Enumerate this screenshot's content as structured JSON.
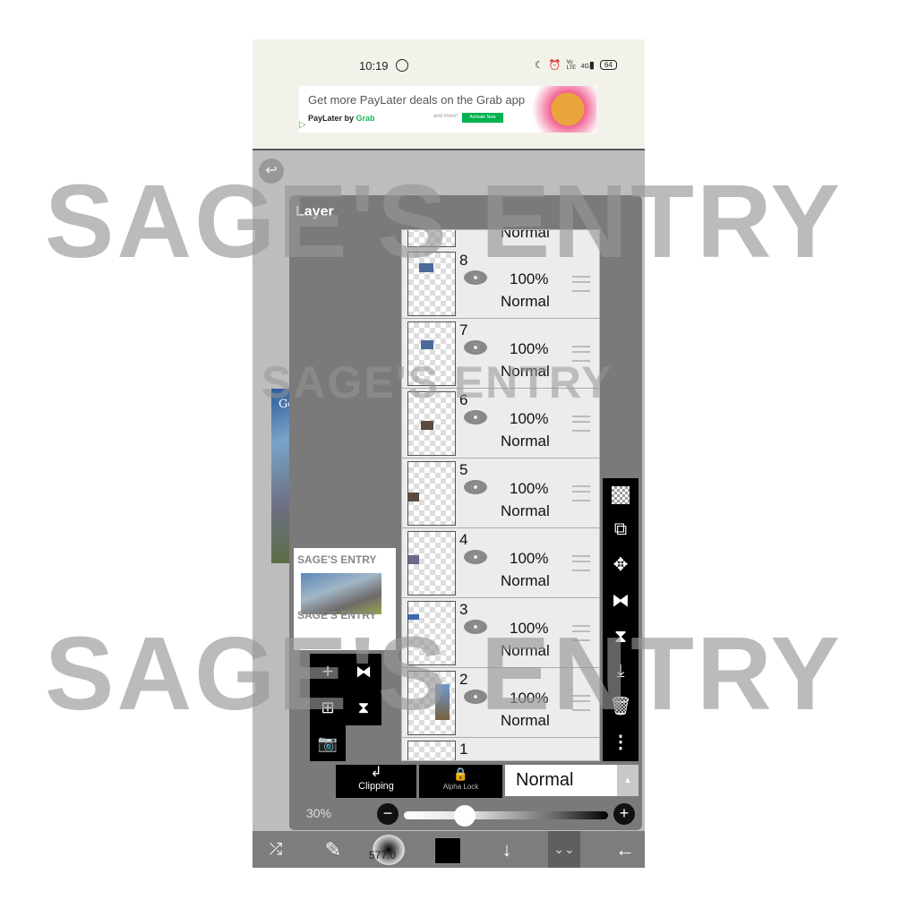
{
  "status_bar": {
    "time": "10:19",
    "icons": [
      "whatsapp-icon",
      "moon-icon",
      "alarm-icon",
      "volte-icon",
      "signal-4g-icon"
    ],
    "volte_label": "Vo LTE",
    "network_label": "4G",
    "battery": "64"
  },
  "ad": {
    "headline": "Get more PayLater deals on the Grab app.",
    "brand_prefix": "PayLater by ",
    "brand_name": "Grab",
    "extra": "and more!",
    "cta": "Activate Now"
  },
  "canvas": {
    "artwork_title": "Genshin",
    "undo_icon": "undo-icon"
  },
  "layer_panel": {
    "title": "Layer",
    "partial_top_mode": "Normal",
    "preview_watermark_top": "SAGE'S ENTRY",
    "preview_watermark_bottom": "SAGE'S ENTRY",
    "layers": [
      {
        "number": "8",
        "opacity": "100%",
        "mode": "Normal",
        "visible": true
      },
      {
        "number": "7",
        "opacity": "100%",
        "mode": "Normal",
        "visible": true
      },
      {
        "number": "6",
        "opacity": "100%",
        "mode": "Normal",
        "visible": true
      },
      {
        "number": "5",
        "opacity": "100%",
        "mode": "Normal",
        "visible": true
      },
      {
        "number": "4",
        "opacity": "100%",
        "mode": "Normal",
        "visible": true
      },
      {
        "number": "3",
        "opacity": "100%",
        "mode": "Normal",
        "visible": true
      },
      {
        "number": "2",
        "opacity": "100%",
        "mode": "Normal",
        "visible": true
      },
      {
        "number": "1",
        "opacity": "",
        "mode": "",
        "visible": true
      }
    ],
    "right_tools": [
      "transparency-icon",
      "swap-layer-icon",
      "move-icon",
      "flip-horizontal-icon",
      "flip-vertical-icon",
      "merge-down-icon",
      "trash-icon",
      "more-icon"
    ],
    "left_tools": [
      "add-layer-icon",
      "flip-horizontal-icon",
      "add-image-layer-icon",
      "flip-vertical-icon",
      "camera-icon"
    ],
    "clipping_label": "Clipping",
    "alpha_lock_label": "Alpha Lock",
    "blend_mode": "Normal",
    "opacity_label": "30%",
    "opacity_value": 0.3
  },
  "bottom_bar": {
    "brush_size": "577.0",
    "color": "#000000",
    "tools": [
      "transform-select-icon",
      "brush-icon",
      "brush-size-icon",
      "color-swatch",
      "download-icon",
      "collapse-icon",
      "back-icon"
    ]
  },
  "watermark": {
    "text": "SAGE'S ENTRY"
  }
}
